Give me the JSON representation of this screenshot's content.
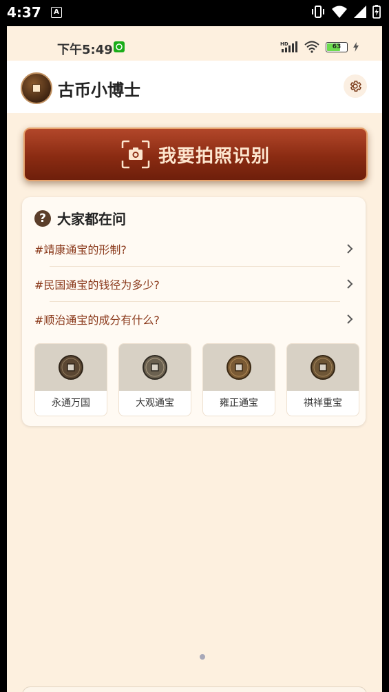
{
  "system_bar": {
    "time": "4:37",
    "a_icon_letter": "A"
  },
  "status_bar": {
    "time": "下午5:49",
    "battery": "63"
  },
  "app": {
    "title": "古币小博士"
  },
  "photo_button": {
    "label": "我要拍照识别"
  },
  "questions": {
    "title": "大家都在问",
    "items": [
      {
        "text": "#靖康通宝的形制?"
      },
      {
        "text": "#民国通宝的钱径为多少?"
      },
      {
        "text": "#顺治通宝的成分有什么?"
      }
    ]
  },
  "coins": [
    {
      "name": "永通万国"
    },
    {
      "name": "大观通宝"
    },
    {
      "name": "雍正通宝"
    },
    {
      "name": "祺祥重宝"
    }
  ],
  "colors": {
    "accent": "#8b2c12",
    "background": "#fdf0df",
    "link": "#8b3a1c"
  }
}
